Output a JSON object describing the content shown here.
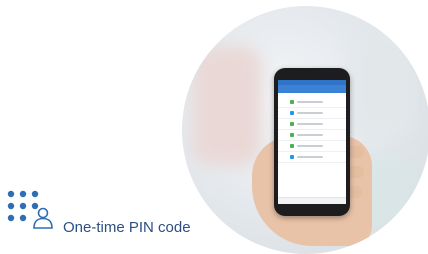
{
  "caption": {
    "label": "One-time PIN code"
  },
  "icons": {
    "pin": "pin-keypad-user-icon",
    "photo": "hand-holding-phone-photo"
  },
  "colors": {
    "accent": "#2d4f83",
    "app_bar": "#3b82d6",
    "icon_blue": "#2f6db5"
  },
  "phone_list": {
    "row_count": 6,
    "row_icon_colors": [
      "#4caf50",
      "#2196f3",
      "#4caf50",
      "#4caf50",
      "#4caf50",
      "#2196f3"
    ]
  }
}
